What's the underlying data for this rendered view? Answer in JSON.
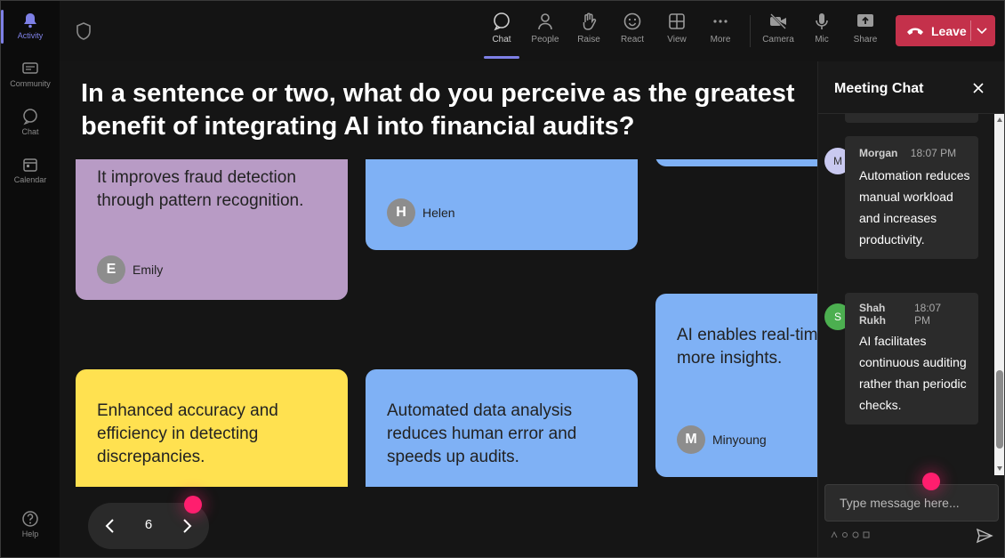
{
  "rail": {
    "items": [
      {
        "label": "Activity",
        "icon": "bell-icon",
        "active": true
      },
      {
        "label": "Community",
        "icon": "community-icon"
      },
      {
        "label": "Chat",
        "icon": "chat-icon"
      },
      {
        "label": "Calendar",
        "icon": "calendar-icon"
      },
      {
        "label": "Help",
        "icon": "help-icon"
      }
    ]
  },
  "toolbar": {
    "buttons": [
      {
        "label": "Chat",
        "icon": "chat-bubble-icon",
        "active": true
      },
      {
        "label": "People",
        "icon": "people-icon"
      },
      {
        "label": "Raise",
        "icon": "raise-hand-icon"
      },
      {
        "label": "React",
        "icon": "react-icon"
      },
      {
        "label": "View",
        "icon": "grid-view-icon"
      },
      {
        "label": "More",
        "icon": "more-icon"
      },
      {
        "label": "Camera",
        "icon": "camera-off-icon"
      },
      {
        "label": "Mic",
        "icon": "mic-icon"
      },
      {
        "label": "Share",
        "icon": "share-icon"
      }
    ],
    "leave_label": "Leave",
    "leave_color": "#c4314b",
    "accent": "#7e80e6"
  },
  "stage": {
    "prompt": "In a sentence or two, what do you perceive as the greatest benefit of integrating AI into financial audits?",
    "cards": [
      {
        "text": "It improves fraud detection through pattern recognition.",
        "author": "Emily",
        "initial": "E",
        "color": "#b89bc5"
      },
      {
        "text": "",
        "author": "Helen",
        "initial": "H",
        "color": "#7fb1f5"
      },
      {
        "text": "",
        "author": "",
        "initial": "",
        "color": "#7fb1f5"
      },
      {
        "text": "AI enables real-time monitoring for more insights.",
        "author": "Minyoung",
        "initial": "M",
        "color": "#7fb1f5"
      },
      {
        "text": "Enhanced accuracy and efficiency in detecting discrepancies.",
        "author": "",
        "initial": "",
        "color": "#ffe150"
      },
      {
        "text": "Automated data analysis reduces human error and speeds up audits.",
        "author": "",
        "initial": "",
        "color": "#7fb1f5"
      }
    ],
    "page": "6"
  },
  "chat": {
    "title": "Meeting Chat",
    "messages": [
      {
        "name": "Morgan",
        "time": "18:07 PM",
        "initial": "M",
        "avatar_color": "#c9c9f0",
        "body": "Automation reduces manual workload and increases productivity."
      },
      {
        "name": "Shah Rukh",
        "time": "18:07 PM",
        "initial": "S",
        "avatar_color": "#4caf50",
        "body": "AI facilitates continuous auditing rather than periodic checks."
      }
    ],
    "compose_placeholder": "Type message here..."
  }
}
